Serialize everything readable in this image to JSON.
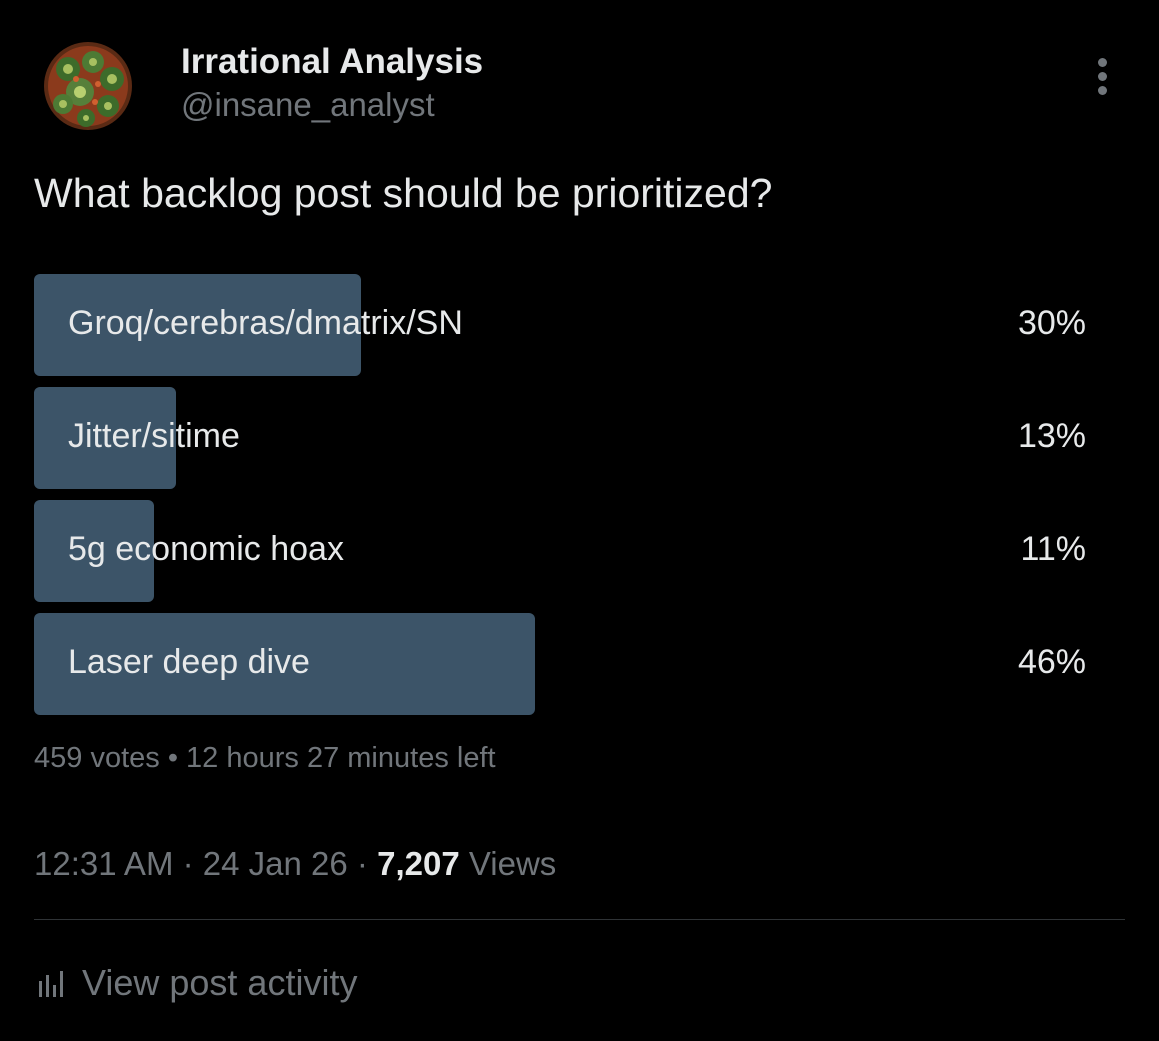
{
  "author": {
    "display_name": "Irrational Analysis",
    "handle": "@insane_analyst",
    "avatar_icon": "fractal-avatar"
  },
  "post": {
    "question": "What backlog post should be prioritized?"
  },
  "poll": {
    "options": [
      {
        "label": "Groq/cerebras/dmatrix/SN",
        "percent_text": "30%",
        "percent": 30
      },
      {
        "label": "Jitter/sitime",
        "percent_text": "13%",
        "percent": 13
      },
      {
        "label": "5g economic hoax",
        "percent_text": "11%",
        "percent": 11
      },
      {
        "label": "Laser deep dive",
        "percent_text": "46%",
        "percent": 46
      }
    ],
    "votes": "459 votes",
    "separator": "•",
    "time_left": "12 hours 27 minutes left",
    "bar_color": "#3c5468"
  },
  "meta": {
    "time": "12:31 AM",
    "date": "24 Jan 26",
    "views_count": "7,207",
    "views_label": "Views",
    "separator": "·"
  },
  "actions": {
    "view_activity_label": "View post activity",
    "view_activity_icon": "bar-chart-icon",
    "more_icon": "more-vertical-icon"
  },
  "colors": {
    "background": "#000000",
    "primary_text": "#e7e9ea",
    "secondary_text": "#71767b",
    "divider": "#2f3336"
  }
}
